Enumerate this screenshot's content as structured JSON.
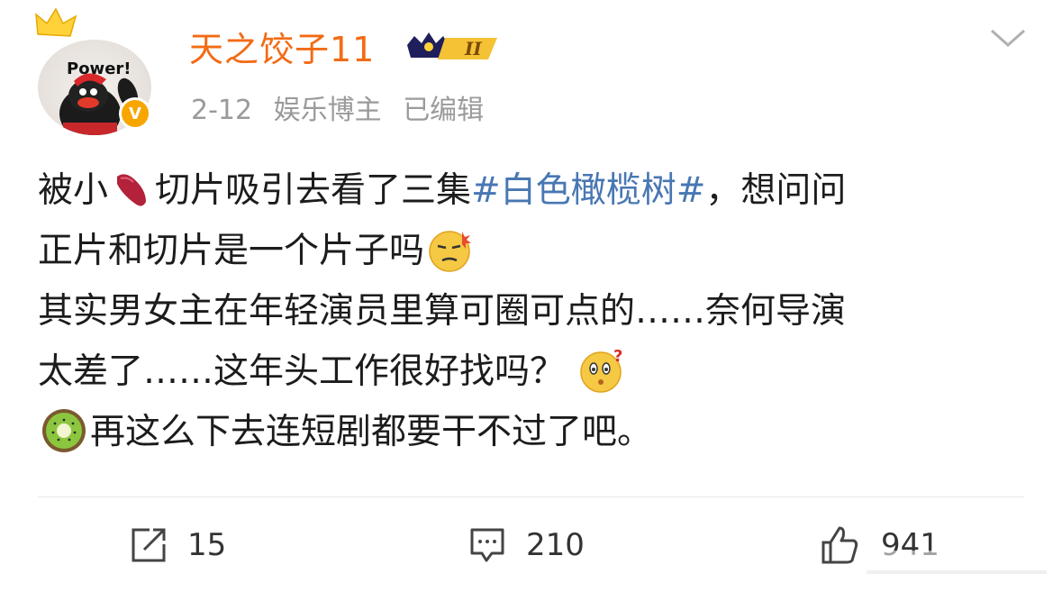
{
  "post": {
    "avatar_text": "Power!",
    "username": "天之饺子11",
    "level_badge": "II",
    "date": "2-12",
    "role": "娱乐博主",
    "edited": "已编辑",
    "verified_mark": "V",
    "content": {
      "l1_a": "被小",
      "l1_b": "切片吸引去看了三集",
      "l1_tag": "#白色橄榄树#",
      "l1_c": "，想问问",
      "l2": "正片和切片是一个片子吗",
      "l3": "其实男女主在年轻演员里算可圈可点的……奈何导演",
      "l4": "太差了……这年头工作很好找吗？",
      "l5": "再这么下去连短剧都要干不过了吧。"
    },
    "actions": {
      "share_count": "15",
      "comment_count": "210",
      "like_count": "941"
    }
  },
  "icons": [
    "crown-icon",
    "verified-icon",
    "level-badge-icon",
    "chevron-down-icon",
    "sweet-potato-emoji",
    "annoyed-face-emoji",
    "confused-face-emoji",
    "kiwi-emoji",
    "share-icon",
    "comment-icon",
    "like-icon"
  ],
  "colors": {
    "username": "#f26b16",
    "hashtag": "#4877b3",
    "meta": "#9a9a9a",
    "badge": "#f7a600"
  }
}
